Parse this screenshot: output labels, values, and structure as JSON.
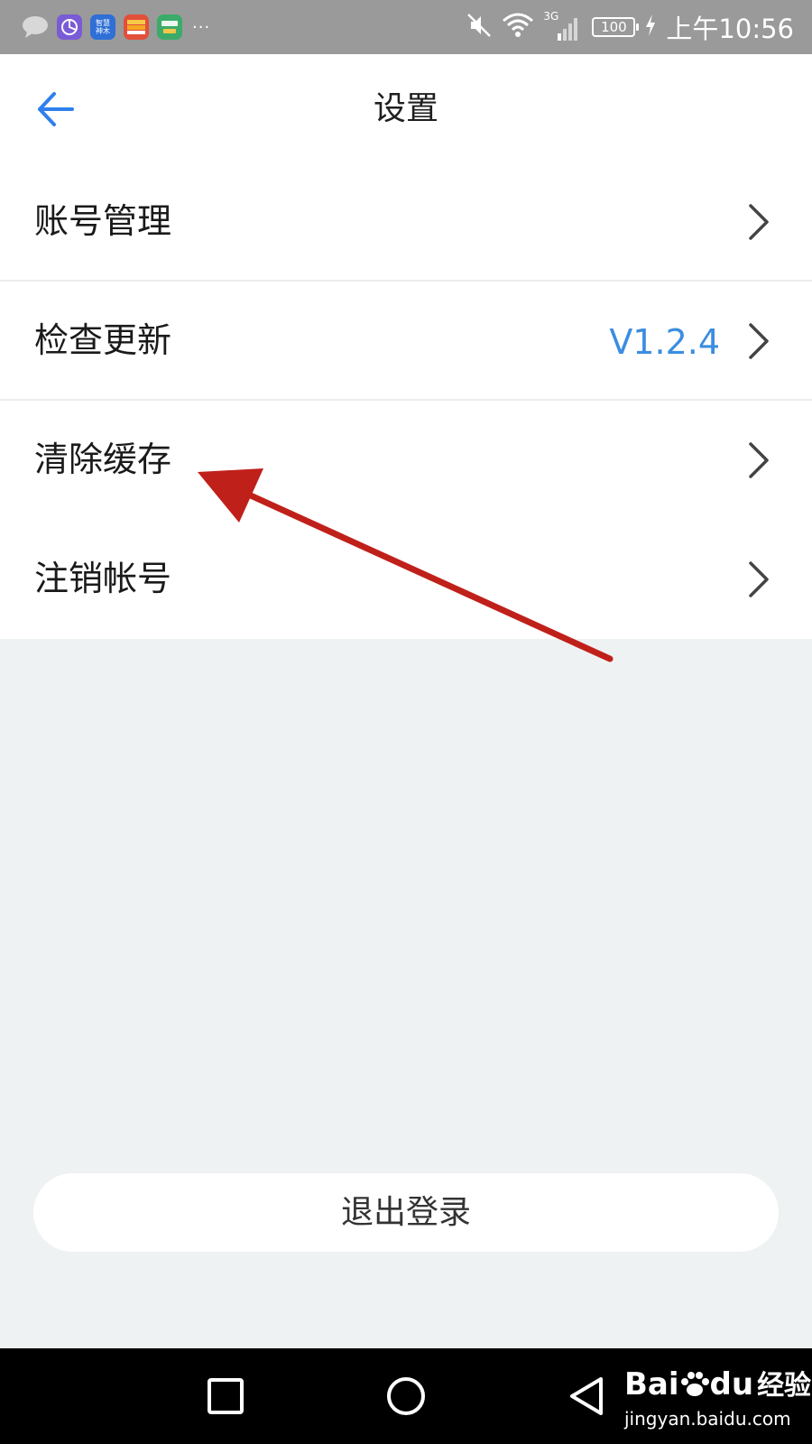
{
  "status_bar": {
    "app_icons": [
      {
        "name": "messages-icon",
        "text": "",
        "color": "#b8b8b8"
      },
      {
        "name": "gallery-app-icon",
        "text": "",
        "color": "#7a5bd6"
      },
      {
        "name": "zhihui-app-icon",
        "text": "智慧\n神木",
        "color": "#2f6fd6"
      },
      {
        "name": "wallet-app-icon",
        "text": "",
        "color": "#e24f3a"
      },
      {
        "name": "green-app-icon",
        "text": "",
        "color": "#3cab6a"
      }
    ],
    "more": "···",
    "network": "3G",
    "battery": "100",
    "time": "上午10:56"
  },
  "header": {
    "title": "设置"
  },
  "settings": {
    "items": [
      {
        "label": "账号管理",
        "value": ""
      },
      {
        "label": "检查更新",
        "value": "V1.2.4"
      },
      {
        "label": "清除缓存",
        "value": ""
      },
      {
        "label": "注销帐号",
        "value": ""
      }
    ]
  },
  "logout": {
    "label": "退出登录"
  },
  "watermark": {
    "logo": "Bai",
    "logo_suffix": "du",
    "logo_cn": "经验",
    "url": "jingyan.baidu.com"
  },
  "colors": {
    "accent": "#2f80ed",
    "value_text": "#3b8de0",
    "annotation": "#c0201a",
    "page_bg": "#eff2f3"
  }
}
